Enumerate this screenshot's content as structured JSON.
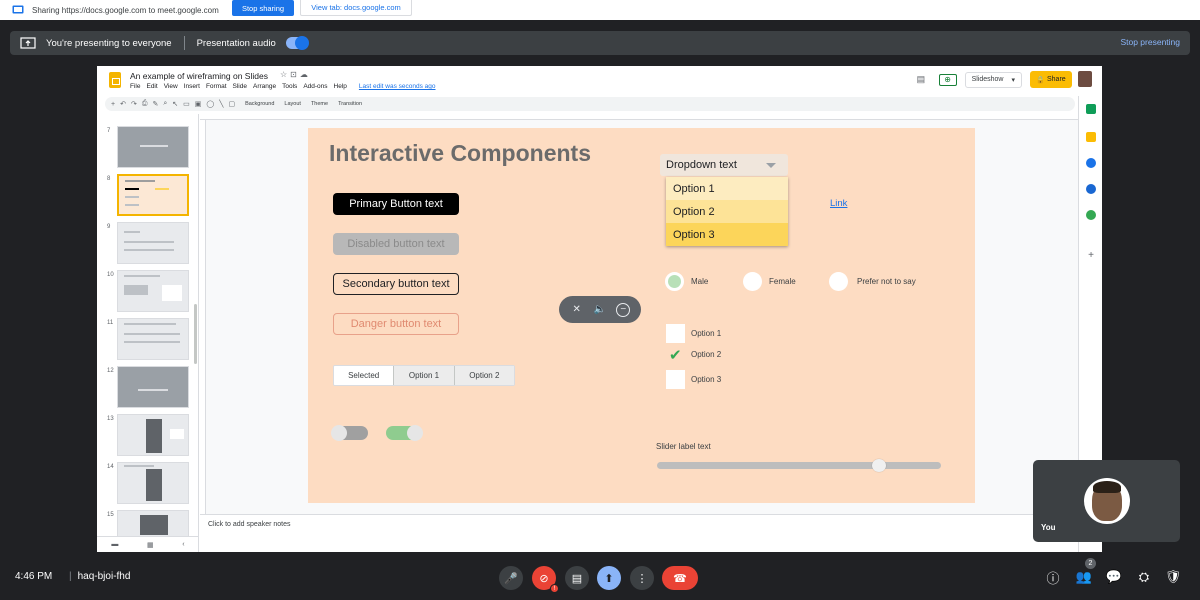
{
  "share_bar": {
    "sharing_text": "Sharing https://docs.google.com to meet.google.com",
    "stop_sharing_label": "Stop sharing",
    "view_tab_label": "View tab: docs.google.com"
  },
  "present_bar": {
    "presenting_text": "You're presenting to everyone",
    "audio_label": "Presentation audio",
    "audio_enabled": true,
    "stop_presenting_label": "Stop presenting"
  },
  "slides": {
    "doc_title": "An example of wireframing on Slides",
    "menus": [
      "File",
      "Edit",
      "View",
      "Insert",
      "Format",
      "Slide",
      "Arrange",
      "Tools",
      "Add-ons",
      "Help"
    ],
    "last_edit": "Last edit was seconds ago",
    "slideshow_label": "Slideshow",
    "share_label": "Share",
    "toolbar": {
      "background": "Background",
      "layout": "Layout",
      "theme": "Theme",
      "transition": "Transition"
    },
    "filmstrip": {
      "numbers": [
        "7",
        "8",
        "9",
        "10",
        "11",
        "12",
        "13",
        "14",
        "15"
      ],
      "selected": "8"
    },
    "notes_placeholder": "Click to add speaker notes"
  },
  "slide_content": {
    "title": "Interactive Components",
    "primary_button": "Primary Button text",
    "disabled_button": "Disabled button text",
    "secondary_button": "Secondary button text",
    "danger_button": "Danger button text",
    "segmented": [
      "Selected",
      "Option 1",
      "Option 2"
    ],
    "toggles": [
      {
        "state": "off"
      },
      {
        "state": "on"
      }
    ],
    "dropdown": {
      "value": "Dropdown text",
      "options": [
        "Option  1",
        "Option  2",
        "Option  3"
      ]
    },
    "link": "Link",
    "radios": [
      {
        "label": "Male",
        "checked": true
      },
      {
        "label": "Female",
        "checked": false
      },
      {
        "label": "Prefer not to say",
        "checked": false
      }
    ],
    "checkboxes": [
      {
        "label": "Option 1",
        "checked": false
      },
      {
        "label": "Option 2",
        "checked": true
      },
      {
        "label": "Option 3",
        "checked": false
      }
    ],
    "slider": {
      "label": "Slider label text",
      "value": 0.78
    }
  },
  "self_tile": {
    "name": "You"
  },
  "bottom_bar": {
    "time": "4:46 PM",
    "meeting_code": "haq-bjoi-fhd",
    "people_count": "2",
    "camera_alert": "!"
  },
  "colors": {
    "meet_bg": "#202124",
    "accent_blue": "#1a73e8",
    "slide_bg": "#fddcc2",
    "hangup_red": "#ea4335",
    "share_yellow": "#fbbc04"
  }
}
